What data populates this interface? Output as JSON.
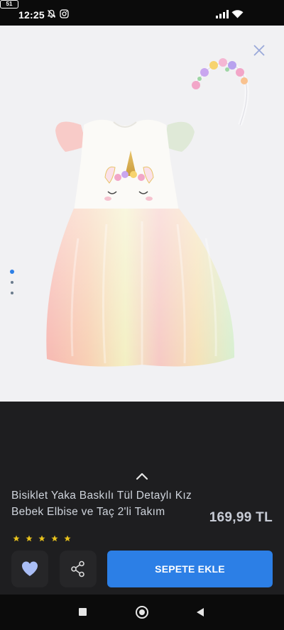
{
  "status_bar": {
    "time": "12:25",
    "battery": "51",
    "icons": [
      "bell-off-icon",
      "instagram-icon",
      "signal-icon",
      "wifi-icon",
      "battery-icon"
    ]
  },
  "gallery": {
    "close_icon": "close-icon",
    "image_count": 3,
    "active_index": 0,
    "accent_color": "#2c7fe6"
  },
  "product": {
    "title": "Bisiklet Yaka Baskılı Tül Detaylı Kız Bebek Elbise ve Taç 2'li Takım",
    "price": "169,99 TL",
    "rating_stars": 5
  },
  "actions": {
    "favorite_icon": "heart-icon",
    "share_icon": "share-icon",
    "add_to_cart_label": "SEPETE EKLE"
  },
  "navigation": {
    "items": [
      "recents-square-icon",
      "home-circle-icon",
      "back-triangle-icon"
    ]
  },
  "colors": {
    "background_dark": "#1e1e20",
    "button_primary": "#2c7fe6",
    "heart": "#a9bdf5",
    "star": "#e8c21c"
  }
}
